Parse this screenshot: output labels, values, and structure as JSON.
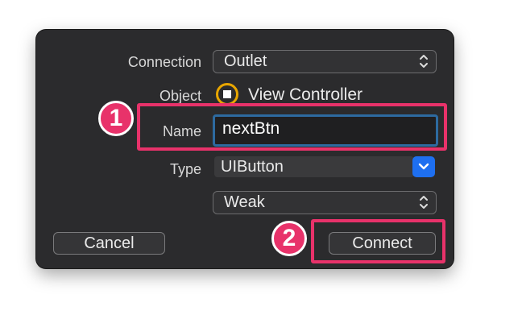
{
  "dialog": {
    "connection": {
      "label": "Connection",
      "value": "Outlet"
    },
    "object": {
      "label": "Object",
      "value": "View Controller"
    },
    "name": {
      "label": "Name",
      "value": "nextBtn"
    },
    "type": {
      "label": "Type",
      "value": "UIButton"
    },
    "storage": {
      "value": "Weak"
    },
    "cancel_label": "Cancel",
    "connect_label": "Connect"
  },
  "annotations": {
    "step1": "1",
    "step2": "2"
  },
  "colors": {
    "annotation": "#e8326a",
    "dialog_bg": "#2b2b2d",
    "focus_ring": "#2d6aa0",
    "combo_button": "#1e6ff0",
    "object_icon": "#e8a600"
  },
  "icons": {
    "popup_chevron": "chevron-up-down-icon",
    "combo_chevron": "chevron-down-icon",
    "object": "view-controller-icon"
  }
}
